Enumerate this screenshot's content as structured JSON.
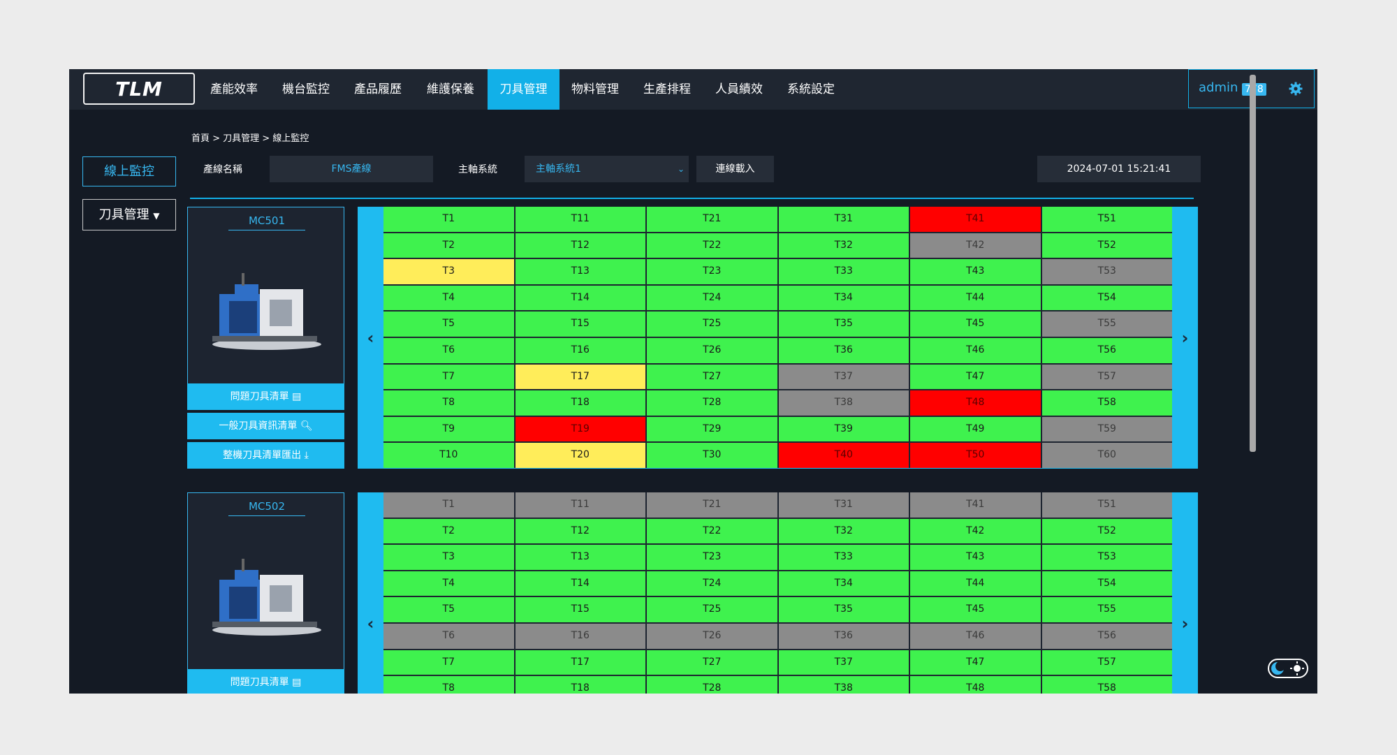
{
  "logo": {
    "text": "TLM"
  },
  "nav": {
    "items": [
      "產能效率",
      "機台監控",
      "產品履歷",
      "維護保養",
      "刀具管理",
      "物料管理",
      "生產排程",
      "人員績效",
      "系統設定"
    ],
    "active_index": 4
  },
  "user": {
    "name": "admin",
    "badge": "778"
  },
  "sidebar": {
    "online_label": "線上監控",
    "tool_label": "刀具管理"
  },
  "breadcrumb": "首頁 > 刀具管理 > 線上監控",
  "filters": {
    "line_label": "產線名稱",
    "line_value": "FMS產線",
    "spindle_label": "主軸系統",
    "spindle_value": "主軸系統1",
    "connect_label": "連線載入",
    "datetime": "2024-07-01 15:21:41"
  },
  "colors": {
    "accent": "#12b0e8",
    "ok": "#3ff24e",
    "warn": "#ffed5a",
    "alarm": "#ff0000",
    "inactive": "#8b8b8b"
  },
  "machines": [
    {
      "name": "MC501",
      "buttons": [
        "問題刀具清單",
        "一般刀具資訊清單",
        "整機刀具清單匯出"
      ],
      "columns": [
        [
          [
            "T1",
            "green"
          ],
          [
            "T2",
            "green"
          ],
          [
            "T3",
            "yellow"
          ],
          [
            "T4",
            "green"
          ],
          [
            "T5",
            "green"
          ],
          [
            "T6",
            "green"
          ],
          [
            "T7",
            "green"
          ],
          [
            "T8",
            "green"
          ],
          [
            "T9",
            "green"
          ],
          [
            "T10",
            "green"
          ]
        ],
        [
          [
            "T11",
            "green"
          ],
          [
            "T12",
            "green"
          ],
          [
            "T13",
            "green"
          ],
          [
            "T14",
            "green"
          ],
          [
            "T15",
            "green"
          ],
          [
            "T16",
            "green"
          ],
          [
            "T17",
            "yellow"
          ],
          [
            "T18",
            "green"
          ],
          [
            "T19",
            "red"
          ],
          [
            "T20",
            "yellow"
          ]
        ],
        [
          [
            "T21",
            "green"
          ],
          [
            "T22",
            "green"
          ],
          [
            "T23",
            "green"
          ],
          [
            "T24",
            "green"
          ],
          [
            "T25",
            "green"
          ],
          [
            "T26",
            "green"
          ],
          [
            "T27",
            "green"
          ],
          [
            "T28",
            "green"
          ],
          [
            "T29",
            "green"
          ],
          [
            "T30",
            "green"
          ]
        ],
        [
          [
            "T31",
            "green"
          ],
          [
            "T32",
            "green"
          ],
          [
            "T33",
            "green"
          ],
          [
            "T34",
            "green"
          ],
          [
            "T35",
            "green"
          ],
          [
            "T36",
            "green"
          ],
          [
            "T37",
            "gray"
          ],
          [
            "T38",
            "gray"
          ],
          [
            "T39",
            "green"
          ],
          [
            "T40",
            "red"
          ]
        ],
        [
          [
            "T41",
            "red"
          ],
          [
            "T42",
            "gray"
          ],
          [
            "T43",
            "green"
          ],
          [
            "T44",
            "green"
          ],
          [
            "T45",
            "green"
          ],
          [
            "T46",
            "green"
          ],
          [
            "T47",
            "green"
          ],
          [
            "T48",
            "red"
          ],
          [
            "T49",
            "green"
          ],
          [
            "T50",
            "red"
          ]
        ],
        [
          [
            "T51",
            "green"
          ],
          [
            "T52",
            "green"
          ],
          [
            "T53",
            "gray"
          ],
          [
            "T54",
            "green"
          ],
          [
            "T55",
            "gray"
          ],
          [
            "T56",
            "green"
          ],
          [
            "T57",
            "gray"
          ],
          [
            "T58",
            "green"
          ],
          [
            "T59",
            "gray"
          ],
          [
            "T60",
            "gray"
          ]
        ]
      ]
    },
    {
      "name": "MC502",
      "buttons": [
        "問題刀具清單"
      ],
      "columns": [
        [
          [
            "T1",
            "gray"
          ],
          [
            "T2",
            "green"
          ],
          [
            "T3",
            "green"
          ],
          [
            "T4",
            "green"
          ],
          [
            "T5",
            "green"
          ],
          [
            "T6",
            "gray"
          ],
          [
            "T7",
            "green"
          ],
          [
            "T8",
            "green"
          ]
        ],
        [
          [
            "T11",
            "gray"
          ],
          [
            "T12",
            "green"
          ],
          [
            "T13",
            "green"
          ],
          [
            "T14",
            "green"
          ],
          [
            "T15",
            "green"
          ],
          [
            "T16",
            "gray"
          ],
          [
            "T17",
            "green"
          ],
          [
            "T18",
            "green"
          ]
        ],
        [
          [
            "T21",
            "gray"
          ],
          [
            "T22",
            "green"
          ],
          [
            "T23",
            "green"
          ],
          [
            "T24",
            "green"
          ],
          [
            "T25",
            "green"
          ],
          [
            "T26",
            "gray"
          ],
          [
            "T27",
            "green"
          ],
          [
            "T28",
            "green"
          ]
        ],
        [
          [
            "T31",
            "gray"
          ],
          [
            "T32",
            "green"
          ],
          [
            "T33",
            "green"
          ],
          [
            "T34",
            "green"
          ],
          [
            "T35",
            "green"
          ],
          [
            "T36",
            "gray"
          ],
          [
            "T37",
            "green"
          ],
          [
            "T38",
            "green"
          ]
        ],
        [
          [
            "T41",
            "gray"
          ],
          [
            "T42",
            "green"
          ],
          [
            "T43",
            "green"
          ],
          [
            "T44",
            "green"
          ],
          [
            "T45",
            "green"
          ],
          [
            "T46",
            "gray"
          ],
          [
            "T47",
            "green"
          ],
          [
            "T48",
            "green"
          ]
        ],
        [
          [
            "T51",
            "gray"
          ],
          [
            "T52",
            "green"
          ],
          [
            "T53",
            "green"
          ],
          [
            "T54",
            "green"
          ],
          [
            "T55",
            "green"
          ],
          [
            "T56",
            "gray"
          ],
          [
            "T57",
            "green"
          ],
          [
            "T58",
            "green"
          ]
        ]
      ]
    }
  ]
}
